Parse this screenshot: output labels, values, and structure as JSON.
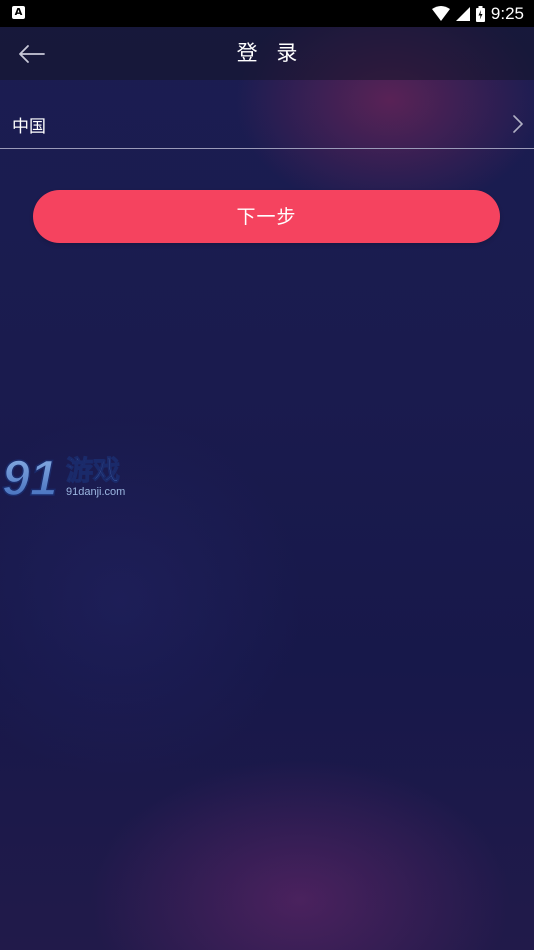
{
  "status_bar": {
    "app_icon_letter": "A",
    "time": "9:25"
  },
  "header": {
    "title": "登 录",
    "back_icon": "arrow-left-icon"
  },
  "country_selector": {
    "value": "中国",
    "chevron_icon": "chevron-right-icon"
  },
  "actions": {
    "next_label": "下一步"
  },
  "watermark": {
    "logo_text": "91游戏",
    "url_text": "91danji.com"
  },
  "colors": {
    "accent": "#f5435f",
    "background_top": "#1b1d52",
    "background_bottom": "#211a4a",
    "divider": "#9a9ab8"
  }
}
